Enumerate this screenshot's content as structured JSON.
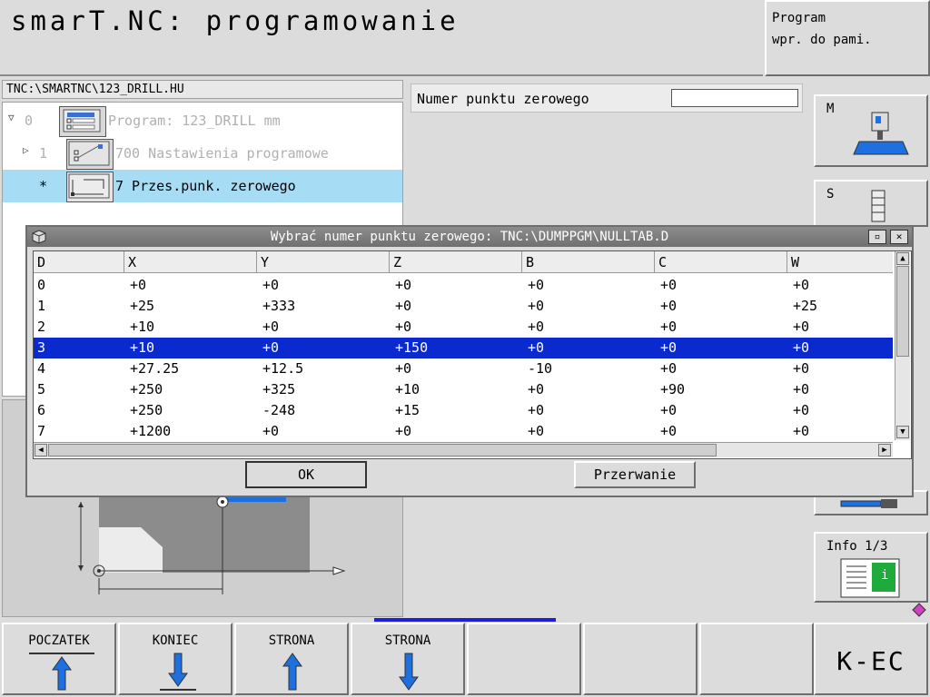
{
  "header": {
    "title": "smarT.NC: programowanie",
    "mode_line1": "Program",
    "mode_line2": "wpr. do pami."
  },
  "tree": {
    "path": "TNC:\\SMARTNC\\123_DRILL.HU",
    "items": [
      {
        "num": "0",
        "label": "Program: 123_DRILL mm"
      },
      {
        "num": "1",
        "label": "700 Nastawienia programowe"
      },
      {
        "num": "*",
        "label": "7 Przes.punk. zerowego"
      }
    ]
  },
  "form": {
    "zero_point_label": "Numer punktu zerowego",
    "zero_point_value": ""
  },
  "dialog": {
    "title": "Wybrać numer punktu zerowego: TNC:\\DUMPPGM\\NULLTAB.D",
    "columns": [
      "D",
      "X",
      "Y",
      "Z",
      "B",
      "C",
      "W"
    ],
    "rows": [
      [
        "0",
        "+0",
        "+0",
        "+0",
        "+0",
        "+0",
        "+0"
      ],
      [
        "1",
        "+25",
        "+333",
        "+0",
        "+0",
        "+0",
        "+25"
      ],
      [
        "2",
        "+10",
        "+0",
        "+0",
        "+0",
        "+0",
        "+0"
      ],
      [
        "3",
        "+10",
        "+0",
        "+150",
        "+0",
        "+0",
        "+0"
      ],
      [
        "4",
        "+27.25",
        "+12.5",
        "+0",
        "-10",
        "+0",
        "+0"
      ],
      [
        "5",
        "+250",
        "+325",
        "+10",
        "+0",
        "+90",
        "+0"
      ],
      [
        "6",
        "+250",
        "-248",
        "+15",
        "+0",
        "+0",
        "+0"
      ],
      [
        "7",
        "+1200",
        "+0",
        "+0",
        "+0",
        "+0",
        "+0"
      ]
    ],
    "selected_row": 3,
    "ok_label": "OK",
    "cancel_label": "Przerwanie"
  },
  "side_keys": {
    "m_label": "M",
    "s_label": "S",
    "info_label": "Info 1/3",
    "info_glyph": "i"
  },
  "bottom_keys": {
    "k1": "POCZATEK",
    "k2": "KONIEC",
    "k3": "STRONA",
    "k4": "STRONA",
    "k8": "K-EC"
  },
  "colors": {
    "selection": "#0a2ad0",
    "tree_highlight": "#a6dcf4",
    "accent_blue": "#1e6fe0",
    "info_green": "#1faa3c"
  }
}
